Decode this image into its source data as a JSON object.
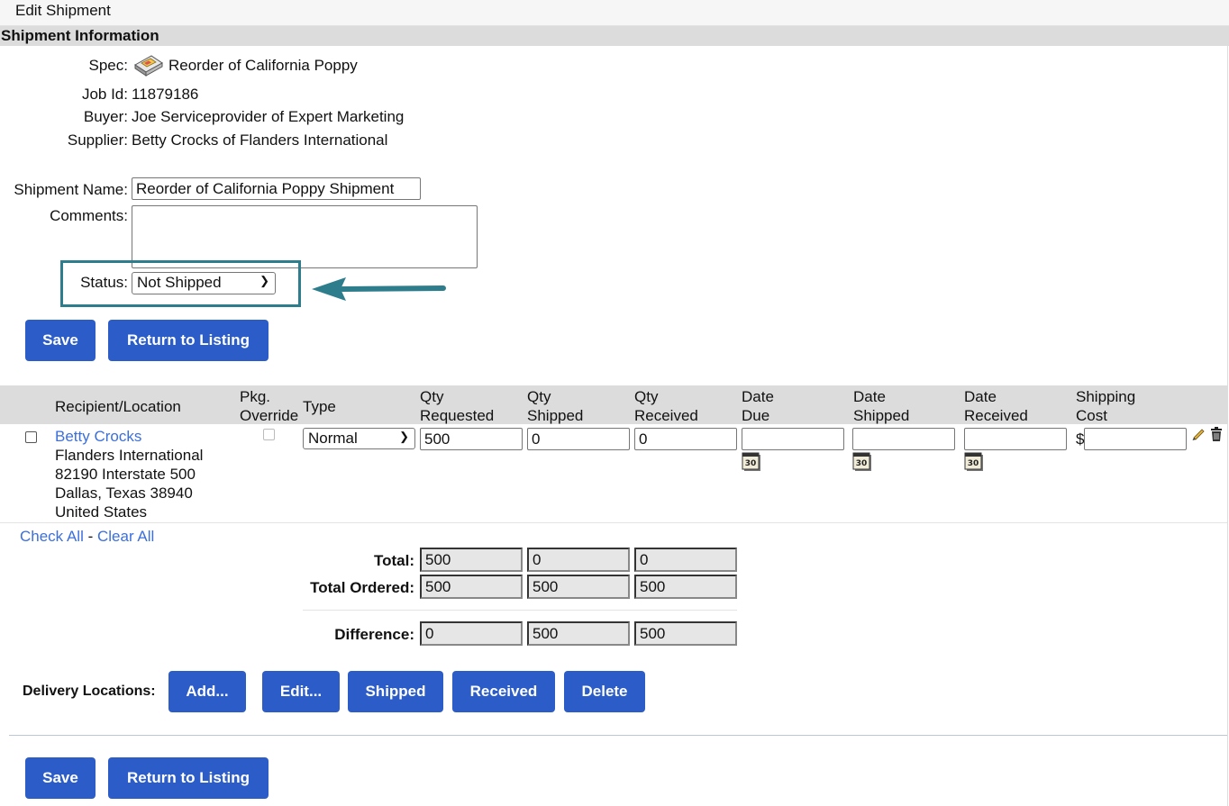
{
  "header": {
    "title": "Edit Shipment",
    "section": "Shipment Information"
  },
  "info": {
    "spec_label": "Spec:",
    "spec_value": "Reorder of California Poppy",
    "job_label": "Job Id:",
    "job_value": "11879186",
    "buyer_label": "Buyer:",
    "buyer_value": "Joe Serviceprovider of Expert Marketing",
    "supplier_label": "Supplier:",
    "supplier_value": "Betty Crocks of Flanders International"
  },
  "form": {
    "name_label": "Shipment Name:",
    "name_value": "Reorder of California Poppy Shipment",
    "comments_label": "Comments:",
    "comments_value": "",
    "status_label": "Status:",
    "status_value": "Not Shipped"
  },
  "buttons": {
    "save": "Save",
    "return": "Return to Listing",
    "add": "Add...",
    "edit": "Edit...",
    "shipped": "Shipped",
    "received": "Received",
    "delete": "Delete"
  },
  "table": {
    "headers": {
      "recipient": "Recipient/Location",
      "pkg1": "Pkg.",
      "pkg2": "Override",
      "type": "Type",
      "qreq1": "Qty",
      "qreq2": "Requested",
      "qship1": "Qty",
      "qship2": "Shipped",
      "qrec1": "Qty",
      "qrec2": "Received",
      "ddue1": "Date",
      "ddue2": "Due",
      "dship1": "Date",
      "dship2": "Shipped",
      "drec1": "Date",
      "drec2": "Received",
      "cost1": "Shipping",
      "cost2": "Cost"
    },
    "row": {
      "name": "Betty Crocks",
      "addr1": "Flanders International",
      "addr2": "82190 Interstate 500",
      "addr3": "Dallas, Texas 38940",
      "addr4": "United States",
      "type": "Normal",
      "qty_requested": "500",
      "qty_shipped": "0",
      "qty_received": "0",
      "date_due": "",
      "date_shipped": "",
      "date_received": "",
      "currency": "$",
      "shipping_cost": ""
    },
    "check_all": "Check All",
    "sep": " - ",
    "clear_all": "Clear All"
  },
  "totals": {
    "total_label": "Total:",
    "total": [
      "500",
      "0",
      "0"
    ],
    "ordered_label": "Total Ordered:",
    "ordered": [
      "500",
      "500",
      "500"
    ],
    "diff_label": "Difference:",
    "diff": [
      "0",
      "500",
      "500"
    ]
  },
  "delivery_label": "Delivery Locations:",
  "calendar_day": "30",
  "colors": {
    "button": "#2b5cc8",
    "link": "#3b6fdc",
    "highlight": "#2e7d8c"
  }
}
